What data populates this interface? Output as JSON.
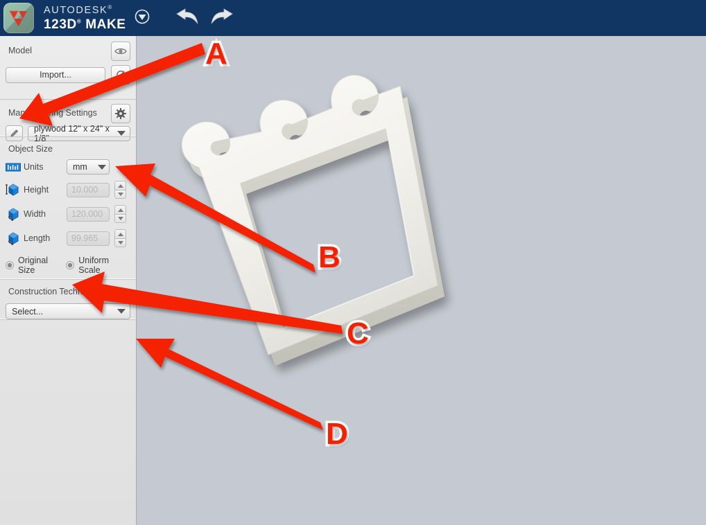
{
  "titlebar": {
    "app_icon_name": "autodesk-123d-app-icon",
    "brand_line1": "AUTODESK",
    "brand_line1_reg": "®",
    "brand_line2": "123D",
    "brand_line2_reg": "®",
    "brand_line2_rest": " MAKE",
    "chevron_label": "chevron-down-icon",
    "undo_label": "undo-arrow-icon",
    "redo_label": "redo-arrow-icon",
    "bg_color": "#123663"
  },
  "sidebar": {
    "model": {
      "title": "Model",
      "visibility_button": "eye-icon",
      "import_button": "Import...",
      "refresh_button": "refresh-icon"
    },
    "manufacturing": {
      "title": "Manufacturing Settings",
      "settings_button": "gear-icon",
      "edit_button": "pencil-icon",
      "material_value": "plywood 12\" x 24\" x 1/8\""
    },
    "object_size": {
      "title": "Object Size",
      "units_label": "Units",
      "units_value": "mm",
      "units_icon": "ruler-icon",
      "fields": [
        {
          "label": "Height",
          "value": "10.000",
          "icon": "cube-height-icon"
        },
        {
          "label": "Width",
          "value": "120.000",
          "icon": "cube-width-icon"
        },
        {
          "label": "Length",
          "value": "99.965",
          "icon": "cube-length-icon"
        }
      ],
      "original_size_label": "Original Size",
      "uniform_scale_label": "Uniform Scale"
    },
    "construction": {
      "title": "Construction Technique",
      "select_value": "Select..."
    }
  },
  "viewport": {
    "background_color": "#c5cad2",
    "model_name": "hanger-3d-model"
  },
  "annotations": {
    "color": "#f42000",
    "outline_color": "#ffffff",
    "items": [
      {
        "letter": "A",
        "target": "manufacturing-edit-pencil-button"
      },
      {
        "letter": "B",
        "target": "units-dropdown"
      },
      {
        "letter": "C",
        "target": "uniform-scale-radio"
      },
      {
        "letter": "D",
        "target": "construction-technique-select"
      }
    ]
  }
}
